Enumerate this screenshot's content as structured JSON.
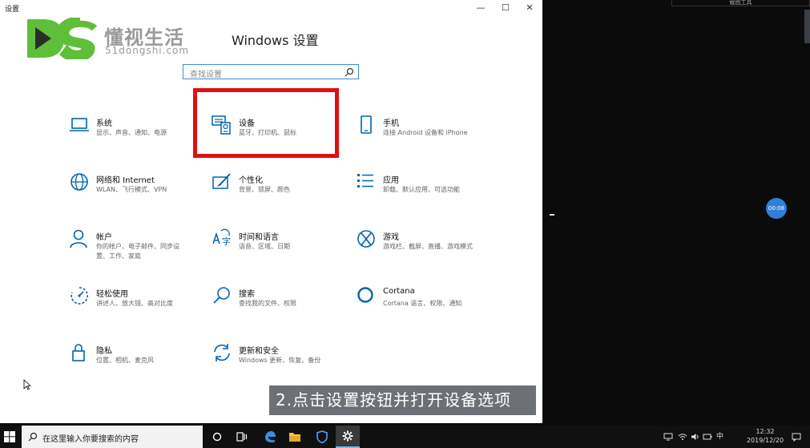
{
  "window": {
    "title": "设置",
    "minimize": "—",
    "maximize": "☐",
    "close": "✕"
  },
  "watermark": {
    "logo_letters": "DS",
    "brand": "懂视生活",
    "url": "51dongshi.com",
    "brand_color": "#5fbf3a"
  },
  "page_title": "Windows 设置",
  "search": {
    "placeholder": "查找设置"
  },
  "tiles": [
    {
      "icon": "laptop-icon",
      "title": "系统",
      "desc": "显示、声音、通知、电源"
    },
    {
      "icon": "keyboard-printer-icon",
      "title": "设备",
      "desc": "蓝牙、打印机、鼠标"
    },
    {
      "icon": "phone-icon",
      "title": "手机",
      "desc": "连接 Android 设备和 iPhone"
    },
    {
      "icon": "globe-icon",
      "title": "网络和 Internet",
      "desc": "WLAN、飞行模式、VPN"
    },
    {
      "icon": "paint-brush-icon",
      "title": "个性化",
      "desc": "背景、锁屏、颜色"
    },
    {
      "icon": "apps-list-icon",
      "title": "应用",
      "desc": "卸载、默认应用、可选功能"
    },
    {
      "icon": "person-icon",
      "title": "帐户",
      "desc": "你的帐户、电子邮件、同步设置、工作、家庭"
    },
    {
      "icon": "time-language-icon",
      "title": "时间和语言",
      "desc": "语音、区域、日期"
    },
    {
      "icon": "xbox-icon",
      "title": "游戏",
      "desc": "游戏栏、截屏、直播、游戏模式"
    },
    {
      "icon": "ease-of-access-icon",
      "title": "轻松使用",
      "desc": "讲述人、放大镜、高对比度"
    },
    {
      "icon": "search-magnifier-icon",
      "title": "搜索",
      "desc": "查找我的文件、权限"
    },
    {
      "icon": "cortana-icon",
      "title": "Cortana",
      "desc": "Cortana 语言、权限、通知"
    },
    {
      "icon": "lock-icon",
      "title": "隐私",
      "desc": "位置、相机、麦克风"
    },
    {
      "icon": "update-sync-icon",
      "title": "更新和安全",
      "desc": "Windows 更新、恢复、备份"
    }
  ],
  "caption": "2.点击设置按钮并打开设备选项",
  "desktop": {
    "top_label": "截图工具",
    "timer": "00:08"
  },
  "taskbar": {
    "search_text": "在这里输入你要搜索的内容",
    "ime": "中",
    "time": "12:32",
    "date": "2019/12/20"
  },
  "colors": {
    "accent": "#0063b1",
    "highlight": "#e01010",
    "caption_bg": "#6d7076"
  }
}
